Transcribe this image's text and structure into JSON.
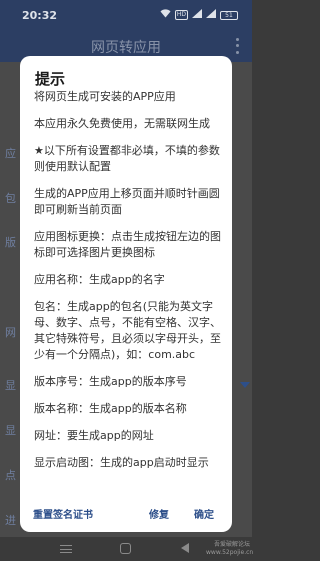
{
  "status_bar": {
    "time": "20:32",
    "signal_badge": "HD",
    "battery": "51"
  },
  "app_bar": {
    "title": "网页转应用"
  },
  "background": {
    "labels": [
      "应",
      "包",
      "版",
      "网",
      "显",
      "显",
      "点",
      "进"
    ]
  },
  "dialog": {
    "title": "提示",
    "paragraphs": [
      "将网页生成可安装的APP应用",
      "本应用永久免费使用，无需联网生成",
      "★以下所有设置都非必填，不填的参数则使用默认配置",
      "生成的APP应用上移页面并顺时针画圆即可刷新当前页面",
      "应用图标更换：点击生成按钮左边的图标即可选择图片更换图标",
      "应用名称：生成app的名字",
      "包名：生成app的包名(只能为英文字母、数字、点号，不能有空格、汉字、其它特殊符号，且必须以字母开头，至少有一个分隔点)，如：com.abc",
      "版本序号：生成app的版本序号",
      "版本名称：生成app的版本名称",
      "网址：要生成app的网址",
      "显示启动图：生成的app启动时显示"
    ],
    "actions": {
      "reset_cert": "重置签名证书",
      "repair": "修复",
      "confirm": "确定"
    }
  },
  "watermark": "吾爱破解论坛 www.52pojie.cn",
  "icons": [
    "wifi-icon",
    "signal-icon",
    "battery-icon",
    "overflow-menu-icon",
    "nav-menu-icon",
    "nav-home-icon",
    "nav-back-icon"
  ],
  "colors": {
    "accent": "#2d4f8a",
    "app_bar": "#2c3e63"
  }
}
